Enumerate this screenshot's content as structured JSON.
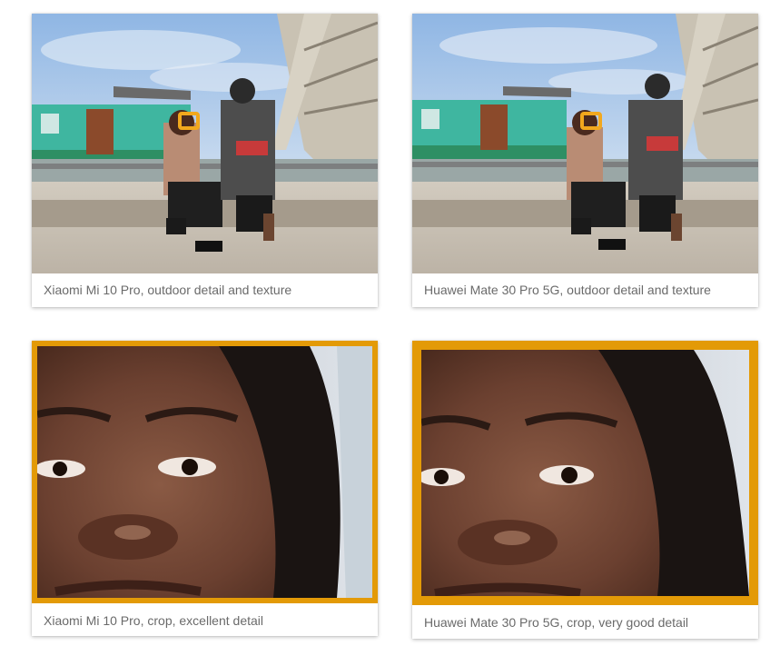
{
  "gallery": {
    "items": [
      {
        "caption": "Xiaomi Mi 10 Pro, outdoor detail and texture",
        "image": "outdoor-scene-xiaomi"
      },
      {
        "caption": "Huawei Mate 30 Pro 5G, outdoor detail and texture",
        "image": "outdoor-scene-huawei"
      },
      {
        "caption": "Xiaomi Mi 10 Pro, crop, excellent detail",
        "image": "face-crop-xiaomi"
      },
      {
        "caption": "Huawei Mate 30 Pro 5G, crop, very good detail",
        "image": "face-crop-huawei"
      }
    ]
  },
  "colors": {
    "crop_border": "#e39a07",
    "highlight_box": "#f2a81d",
    "caption_text": "#6a6a6a"
  }
}
